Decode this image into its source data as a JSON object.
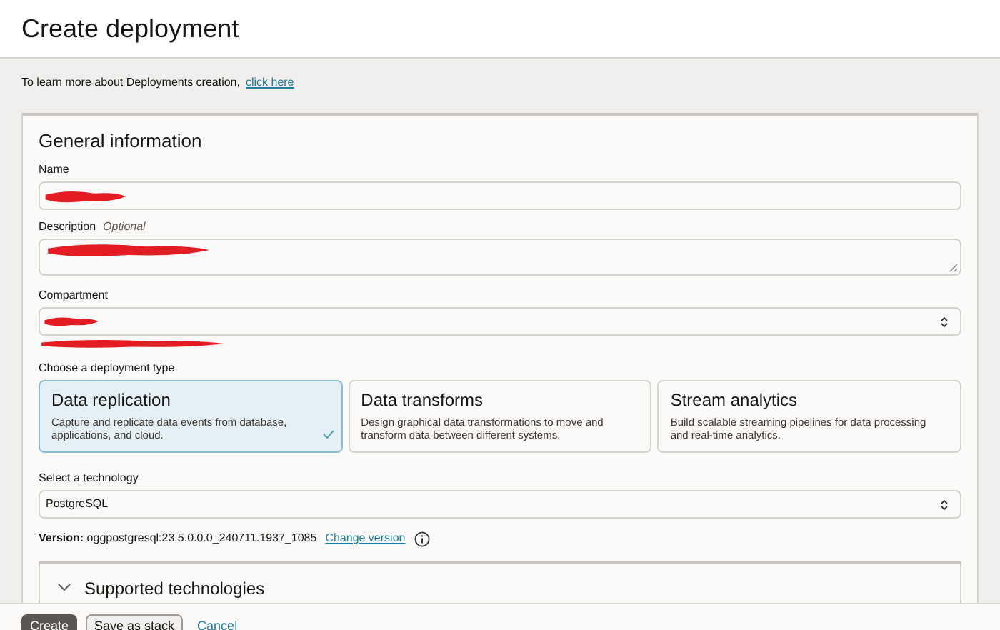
{
  "window": {
    "title": "Create deployment"
  },
  "intro": {
    "text": "To learn more about Deployments creation,",
    "link": "click here"
  },
  "section": {
    "title": "General information",
    "name": {
      "label": "Name",
      "redacted": true
    },
    "description": {
      "label": "Description",
      "hint": "Optional",
      "redacted": true
    },
    "compartment": {
      "label": "Compartment",
      "redacted": true,
      "below_redacted": true
    },
    "deployment_type": {
      "label": "Choose a deployment type",
      "options": [
        {
          "title": "Data replication",
          "text": "Capture and replicate data events from database, applications, and cloud.",
          "selected": true
        },
        {
          "title": "Data transforms",
          "text": "Design graphical data transformations to move and transform data between different systems.",
          "selected": false
        },
        {
          "title": "Stream analytics",
          "text": "Build scalable streaming pipelines for data processing and real-time analytics.",
          "selected": false
        }
      ]
    },
    "technology": {
      "label": "Select a technology",
      "value": "PostgreSQL"
    },
    "version": {
      "text": "**Version:** oggpostgresql:23.5.0.0.0_240711.1937_1085",
      "link": "Change version"
    },
    "supported": {
      "title": "Supported technologies",
      "expanded": false
    }
  },
  "footer": {
    "buttons": [
      {
        "label": "Create",
        "kind": "primary"
      },
      {
        "label": "Save as stack",
        "kind": "secondary"
      },
      {
        "label": "Cancel",
        "kind": "link"
      }
    ]
  }
}
